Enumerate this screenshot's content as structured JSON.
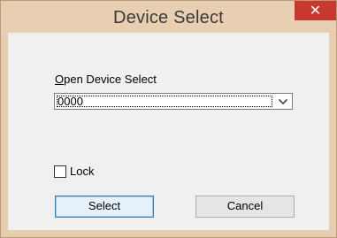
{
  "window": {
    "title": "Device Select",
    "close_glyph": "✕",
    "accent_close": "#c7382e",
    "titlebar_color": "#e8cfb2"
  },
  "form": {
    "open_label_mnemonic": "O",
    "open_label_rest": "pen Device Select",
    "device_select": {
      "selected_value": "0000",
      "arrow_icon": "chevron-down-icon"
    },
    "lock": {
      "label": "Lock",
      "checked": false
    }
  },
  "buttons": {
    "select_label": "Select",
    "cancel_label": "Cancel"
  }
}
